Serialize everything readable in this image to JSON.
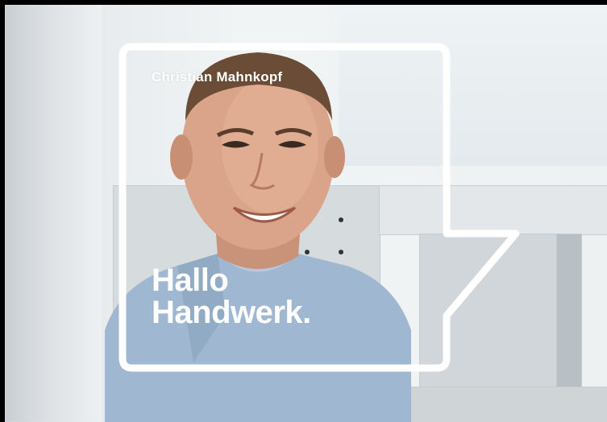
{
  "overlay": {
    "name": "Christian Mahnkopf",
    "slogan_line1": "Hallo",
    "slogan_line2": "Handwerk."
  },
  "colors": {
    "frame": "#ffffff",
    "text": "#ffffff",
    "shirt": "#9bb4cf",
    "background": "#eef1f2"
  }
}
